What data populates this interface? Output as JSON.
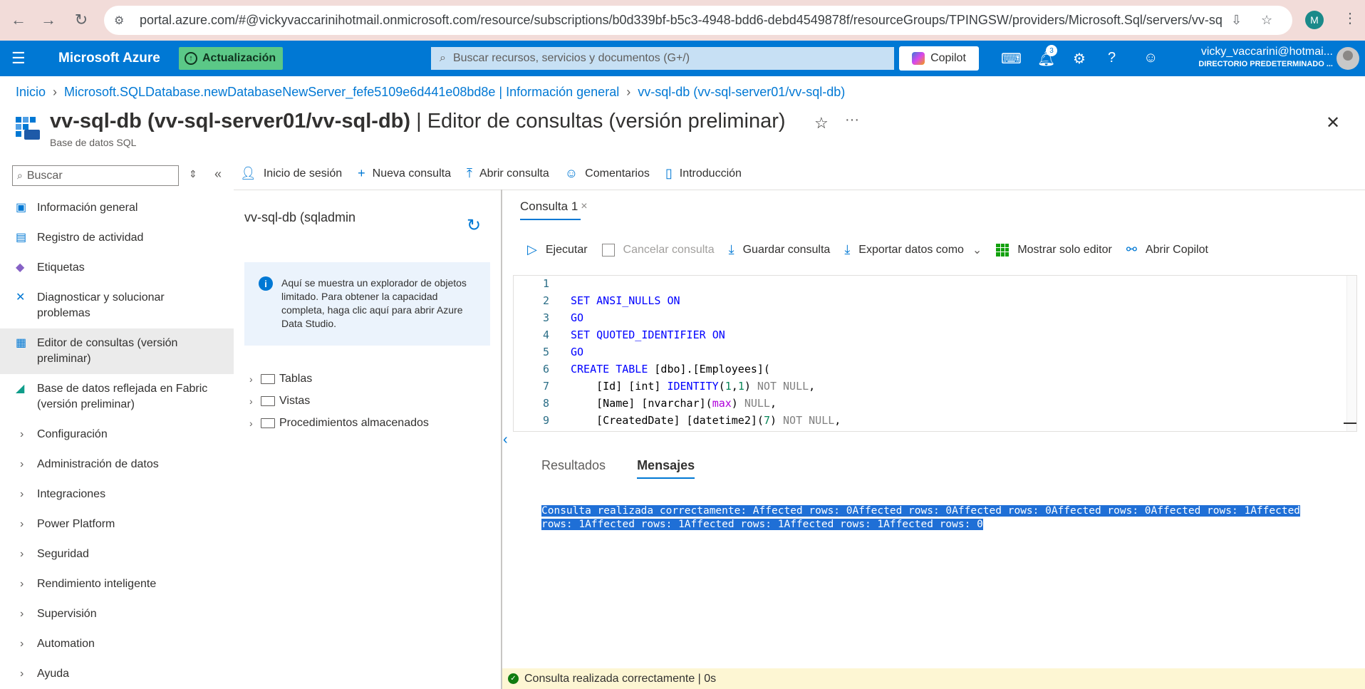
{
  "browser": {
    "url": "portal.azure.com/#@vickyvaccarinihotmail.onmicrosoft.com/resource/subscriptions/b0d339bf-b5c3-4948-bdd6-debd4549878f/resourceGroups/TPINGSW/providers/Microsoft.Sql/servers/vv-sql-s...",
    "profile_initial": "M"
  },
  "header": {
    "brand": "Microsoft Azure",
    "update_label": "Actualización",
    "search_placeholder": "Buscar recursos, servicios y documentos (G+/)",
    "copilot_label": "Copilot",
    "notifications_count": "3",
    "user_name": "vicky_vaccarini@hotmai...",
    "user_directory": "DIRECTORIO PREDETERMINADO ..."
  },
  "breadcrumb": [
    "Inicio",
    "Microsoft.SQLDatabase.newDatabaseNewServer_fefe5109e6d441e08bd8e | Información general",
    "vv-sql-db (vv-sql-server01/vv-sql-db)"
  ],
  "page": {
    "title_resource": "vv-sql-db (vv-sql-server01/vv-sql-db)",
    "title_blade": " | Editor de consultas (versión preliminar)",
    "subtitle": "Base de datos SQL"
  },
  "sidebar": {
    "search_placeholder": "Buscar",
    "items": [
      {
        "label": "Información general",
        "icon": "sql-icon"
      },
      {
        "label": "Registro de actividad",
        "icon": "log-icon"
      },
      {
        "label": "Etiquetas",
        "icon": "tag-icon"
      },
      {
        "label": "Diagnosticar y solucionar problemas",
        "icon": "wrench-icon"
      },
      {
        "label": "Editor de consultas (versión preliminar)",
        "icon": "query-editor-icon"
      },
      {
        "label": "Base de datos reflejada en Fabric (versión preliminar)",
        "icon": "fabric-icon"
      },
      {
        "label": "Configuración"
      },
      {
        "label": "Administración de datos"
      },
      {
        "label": "Integraciones"
      },
      {
        "label": "Power Platform"
      },
      {
        "label": "Seguridad"
      },
      {
        "label": "Rendimiento inteligente"
      },
      {
        "label": "Supervisión"
      },
      {
        "label": "Automation"
      },
      {
        "label": "Ayuda"
      }
    ]
  },
  "commands": {
    "login": "Inicio de sesión",
    "new_query": "Nueva consulta",
    "open_query": "Abrir consulta",
    "feedback": "Comentarios",
    "intro": "Introducción"
  },
  "explorer": {
    "connection": "vv-sql-db (sqladmin",
    "info": "Aquí se muestra un explorador de objetos limitado. Para obtener la capacidad completa, haga clic aquí para abrir Azure Data Studio.",
    "nodes": [
      "Tablas",
      "Vistas",
      "Procedimientos almacenados"
    ]
  },
  "editor": {
    "tab_label": "Consulta 1",
    "tools": {
      "run": "Ejecutar",
      "cancel": "Cancelar consulta",
      "save": "Guardar consulta",
      "export": "Exportar datos como",
      "editor_only": "Mostrar solo editor",
      "copilot": "Abrir Copilot"
    },
    "line_numbers": [
      "1",
      "2",
      "3",
      "4",
      "5",
      "6",
      "7",
      "8",
      "9"
    ]
  },
  "results": {
    "tab_results": "Resultados",
    "tab_messages": "Mensajes",
    "message": "Consulta realizada correctamente: Affected rows: 0Affected rows: 0Affected rows: 0Affected rows: 0Affected rows: 1Affected rows: 1Affected rows: 1Affected rows: 1Affected rows: 1Affected rows: 0"
  },
  "status": {
    "text": "Consulta realizada correctamente | 0s"
  },
  "colors": {
    "azure_blue": "#0078d4",
    "update_green": "#5bc887",
    "selection": "#1f6fd6",
    "status_bg": "#fdf6d3"
  }
}
